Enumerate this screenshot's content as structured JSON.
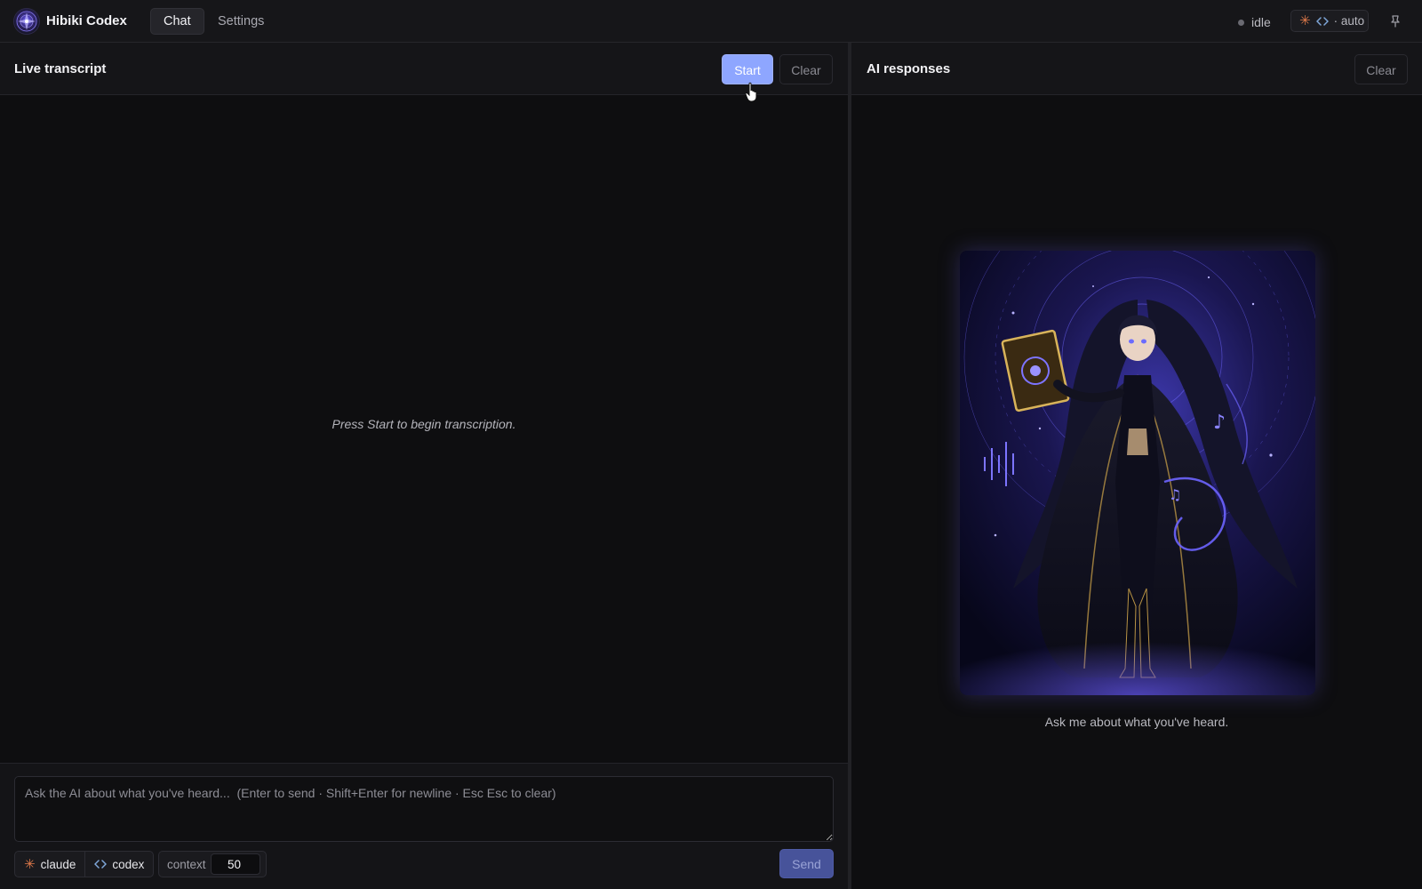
{
  "app": {
    "title": "Hibiki Codex",
    "logo_icon": "magic-circle-icon"
  },
  "nav": {
    "tabs": [
      {
        "label": "Chat",
        "active": true
      },
      {
        "label": "Settings",
        "active": false
      }
    ]
  },
  "status": {
    "label": "idle",
    "dot_color": "#6a6a72"
  },
  "mode": {
    "label": "· auto",
    "icons": [
      "claude-asterisk-icon",
      "code-brackets-icon"
    ]
  },
  "pin_icon": "pin-icon",
  "transcript": {
    "title": "Live transcript",
    "start_label": "Start",
    "clear_label": "Clear",
    "empty_message": "Press Start to begin transcription."
  },
  "composer": {
    "placeholder": "Ask the AI about what you've heard...  (Enter to send · Shift+Enter for newline · Esc Esc to clear)",
    "value": "",
    "models": [
      {
        "label": "claude",
        "icon": "claude-asterisk-icon"
      },
      {
        "label": "codex",
        "icon": "code-brackets-icon"
      }
    ],
    "context_label": "context",
    "context_value": "50",
    "send_label": "Send"
  },
  "responses": {
    "title": "AI responses",
    "clear_label": "Clear",
    "hero_image": "anime-sorceress-with-book-illustration",
    "empty_message": "Ask me about what you've heard."
  },
  "colors": {
    "accent": "#8ea6ff",
    "send_disabled": "#47539a",
    "claude_orange": "#e07a4a",
    "background": "#0e0e10"
  }
}
